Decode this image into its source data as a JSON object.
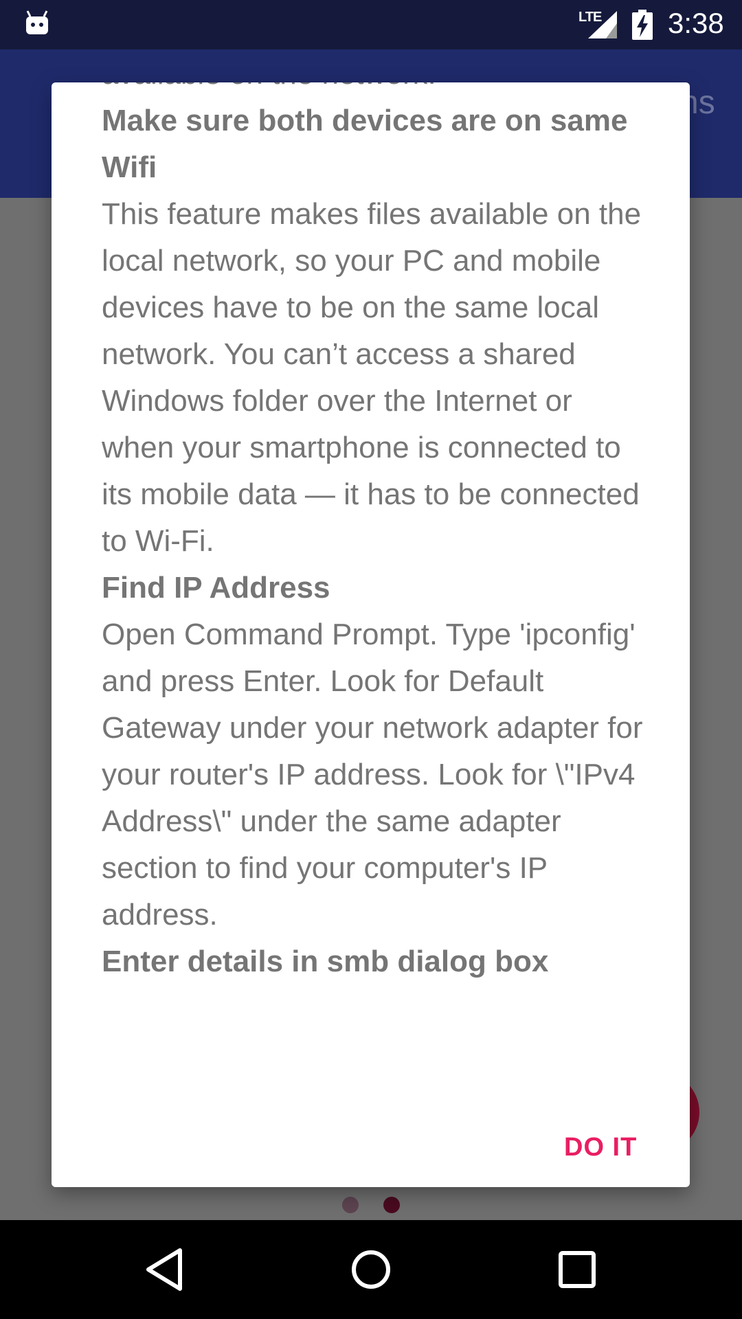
{
  "status_bar": {
    "network": "LTE",
    "time": "3:38",
    "icons": [
      "android-notification-icon",
      "lte-signal-icon",
      "battery-charging-icon"
    ]
  },
  "app_bar": {
    "title_fragment": "ns"
  },
  "dialog": {
    "partial_top_line": "available on the network.",
    "sections": [
      {
        "heading": "Make sure both devices are on same Wifi",
        "body": "This feature makes files available on the local network, so your PC and mobile devices have to be on the same local network. You can’t access a shared Windows folder over the Internet or when your smartphone is connected to its mobile data — it has to be connected to Wi-Fi."
      },
      {
        "heading": "Find IP Address",
        "body": "Open Command Prompt. Type 'ipconfig' and press Enter. Look for Default Gateway under your network adapter for your router's IP address. Look for \\\"IPv4 Address\\\" under the same adapter section to find your computer's IP address."
      },
      {
        "heading": "Enter details in smb dialog box",
        "body": ""
      }
    ],
    "action_label": "DO IT",
    "action_color": "#e91e63"
  },
  "pager": {
    "count": 2,
    "active_index": 1
  },
  "nav_bar": {
    "buttons": [
      "back-icon",
      "home-icon",
      "recents-icon"
    ]
  }
}
